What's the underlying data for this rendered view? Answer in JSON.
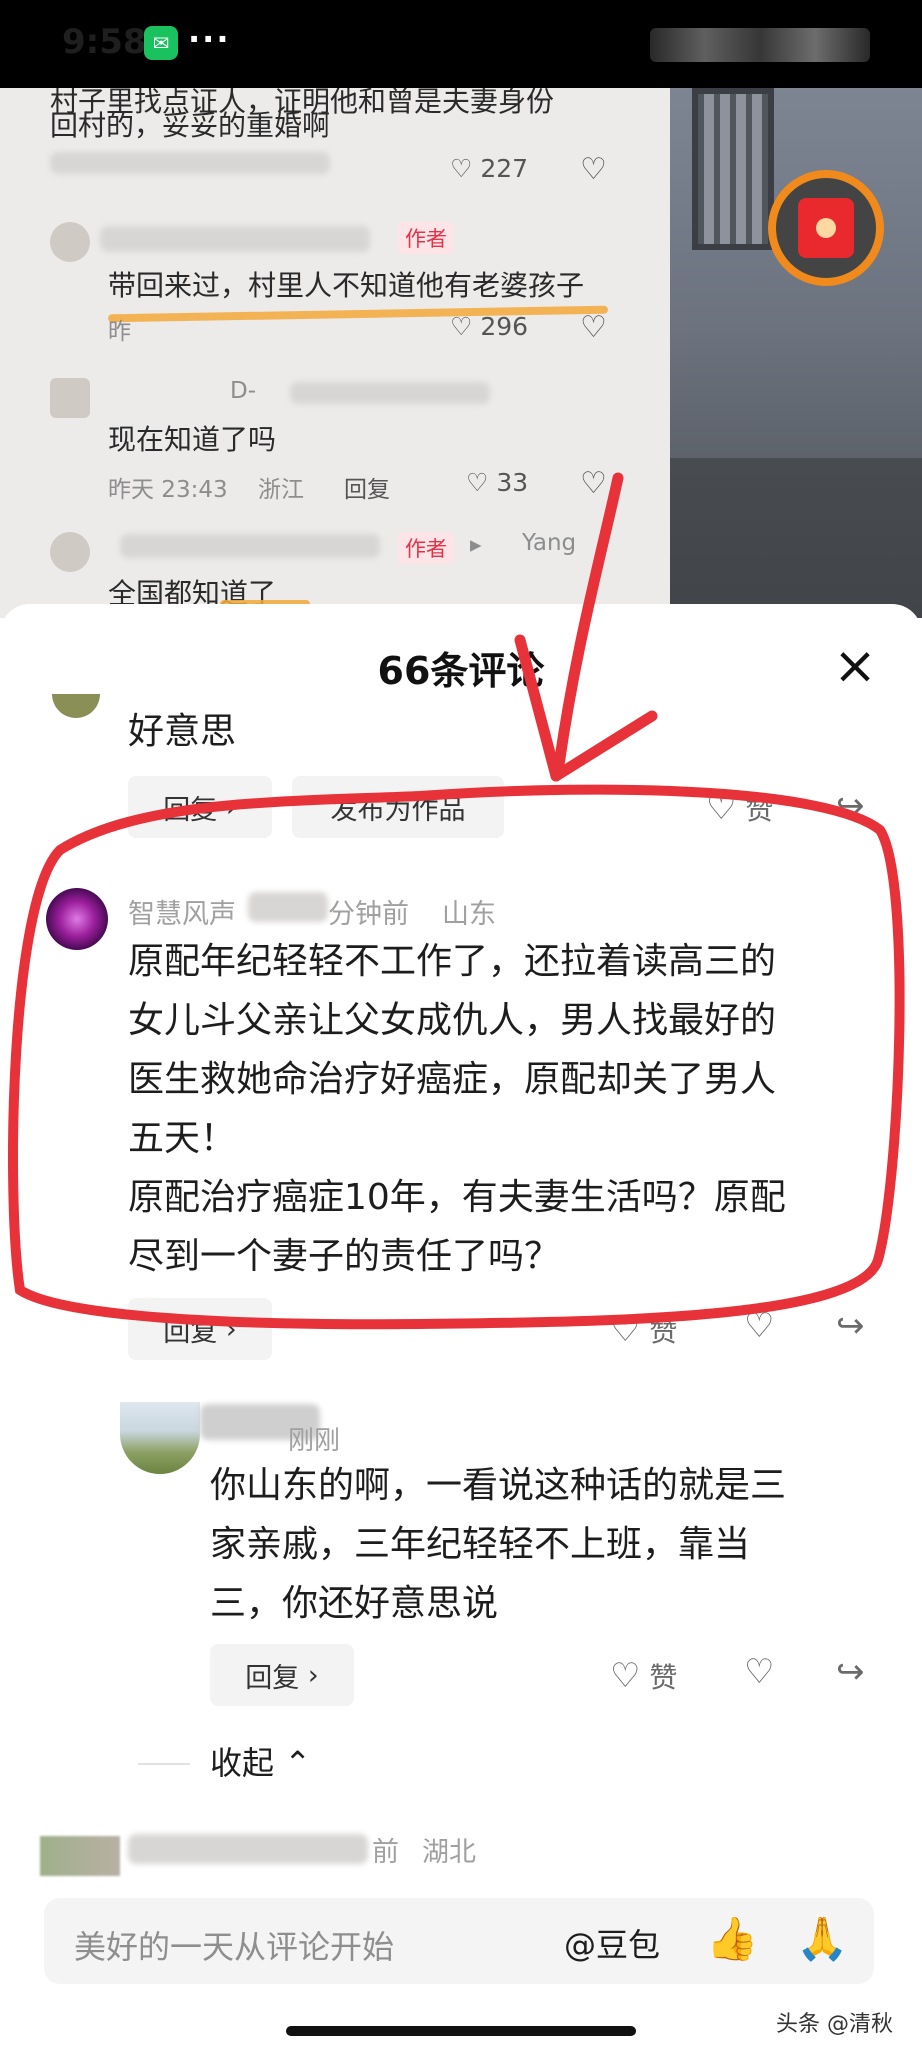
{
  "status_bar": {
    "time": "9:58",
    "more": "···"
  },
  "background": {
    "comments": [
      {
        "text_line1": "村子里找点证人，证明他和曾是夫妻身份",
        "text_line2": "回村的，妥妥的重婚啊",
        "likes": "227"
      },
      {
        "tag": "作者",
        "text": "带回来过，村里人不知道他有老婆孩子",
        "meta": "昨",
        "likes": "296"
      },
      {
        "username": "D-",
        "text": "现在知道了吗",
        "time": "昨天 23:43",
        "location": "浙江",
        "reply": "回复",
        "likes": "33"
      },
      {
        "tag": "作者",
        "reply_to": "Yang",
        "text": "全国都知道了"
      }
    ]
  },
  "sheet": {
    "title": "66条评论",
    "close_icon": "close-icon",
    "partial_comment": {
      "text": "好意思",
      "reply": "回复",
      "publish": "发布为作品",
      "like": "赞"
    },
    "main_comment": {
      "username": "智慧风声",
      "time": "分钟前",
      "location": "山东",
      "lines": [
        "原配年纪轻轻不工作了，还拉着读高三的",
        "女儿斗父亲让父女成仇人，男人找最好的",
        "医生救她命治疗好癌症，原配却关了男人",
        "五天！",
        "原配治疗癌症10年，有夫妻生活吗？原配",
        "尽到一个妻子的责任了吗？"
      ],
      "reply": "回复",
      "like": "赞"
    },
    "sub_reply": {
      "username": "刚刚",
      "lines": [
        "你山东的啊，一看说这种话的就是三",
        "家亲戚，三年纪轻轻不上班，靠当",
        "三，你还好意思说"
      ],
      "reply": "回复",
      "like": "赞"
    },
    "collapse": "收起",
    "next_comment": {
      "time": "前",
      "location": "湖北"
    }
  },
  "input_bar": {
    "placeholder": "美好的一天从评论开始",
    "at_label": "@豆包",
    "emoji_1": "👍",
    "emoji_2": "🙏"
  },
  "watermark": "头条 @清秋",
  "colors": {
    "annotation_red": "#e8323a",
    "author_tag": "#e23348",
    "highlight_orange": "#f5a93b"
  }
}
